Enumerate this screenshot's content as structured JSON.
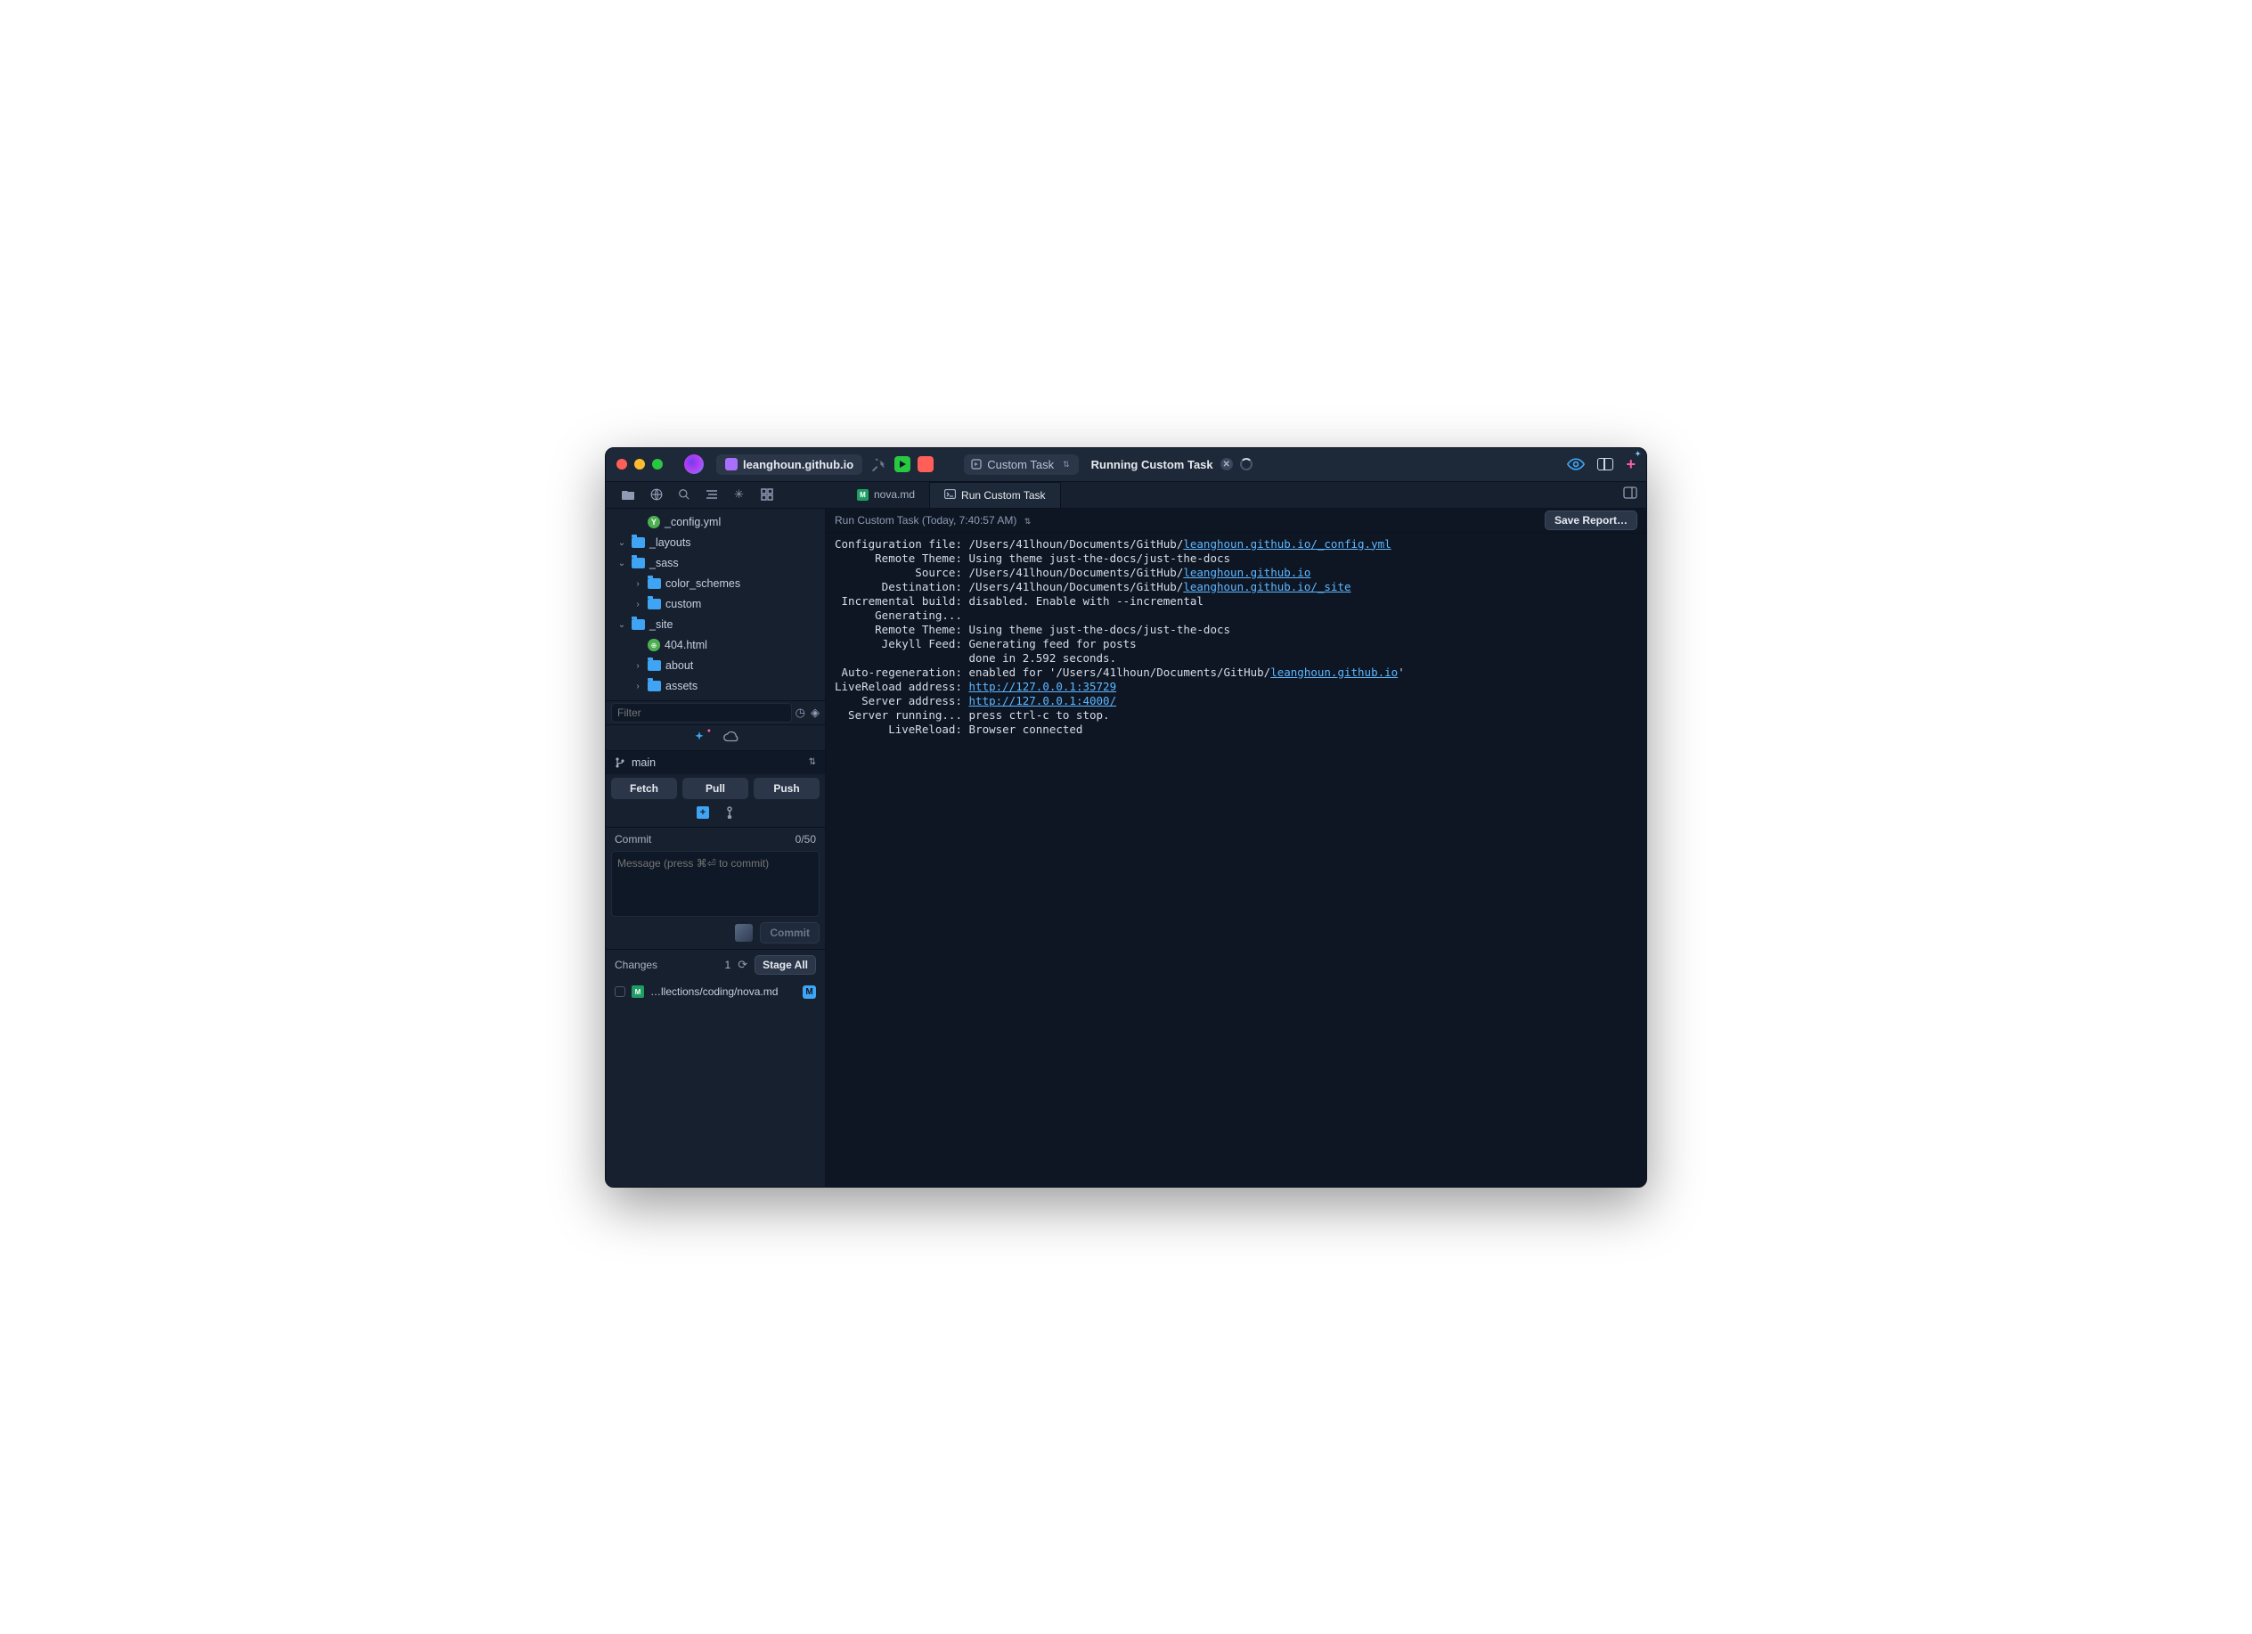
{
  "titlebar": {
    "project_name": "leanghoun.github.io",
    "task_selector_label": "Custom Task",
    "running_label": "Running Custom Task"
  },
  "editor_tabs": [
    {
      "label": "nova.md",
      "active": false
    },
    {
      "label": "Run Custom Task",
      "active": true
    }
  ],
  "file_tree": {
    "items": [
      {
        "depth": 2,
        "type": "file-yml",
        "label": "_config.yml",
        "chevron": ""
      },
      {
        "depth": 1,
        "type": "folder",
        "label": "_layouts",
        "chevron": "v"
      },
      {
        "depth": 1,
        "type": "folder",
        "label": "_sass",
        "chevron": "v"
      },
      {
        "depth": 2,
        "type": "folder",
        "label": "color_schemes",
        "chevron": ">"
      },
      {
        "depth": 2,
        "type": "folder",
        "label": "custom",
        "chevron": ">"
      },
      {
        "depth": 1,
        "type": "folder",
        "label": "_site",
        "chevron": "v"
      },
      {
        "depth": 2,
        "type": "file-html",
        "label": "404.html",
        "chevron": ""
      },
      {
        "depth": 2,
        "type": "folder",
        "label": "about",
        "chevron": ">"
      },
      {
        "depth": 2,
        "type": "folder",
        "label": "assets",
        "chevron": ">"
      }
    ]
  },
  "filter": {
    "placeholder": "Filter"
  },
  "git": {
    "branch": "main",
    "fetch": "Fetch",
    "pull": "Pull",
    "push": "Push",
    "commit_label": "Commit",
    "commit_counter": "0/50",
    "commit_placeholder": "Message (press ⌘⏎ to commit)",
    "commit_button": "Commit",
    "changes_label": "Changes",
    "changes_count": "1",
    "stage_all": "Stage All",
    "changed_file": "…llections/coding/nova.md",
    "changed_badge": "M"
  },
  "breadcrumb": {
    "text": "Run Custom Task (Today, 7:40:57 AM)",
    "save_report": "Save Report…"
  },
  "terminal": {
    "lines": [
      {
        "label": "Configuration file:",
        "pre": " /Users/41lhoun/Documents/GitHub/",
        "link": "leanghoun.github.io/_config.yml",
        "post": ""
      },
      {
        "label": "      Remote Theme:",
        "pre": " Using theme just-the-docs/just-the-docs",
        "link": "",
        "post": ""
      },
      {
        "label": "            Source:",
        "pre": " /Users/41lhoun/Documents/GitHub/",
        "link": "leanghoun.github.io",
        "post": ""
      },
      {
        "label": "       Destination:",
        "pre": " /Users/41lhoun/Documents/GitHub/",
        "link": "leanghoun.github.io/_site",
        "post": ""
      },
      {
        "label": " Incremental build:",
        "pre": " disabled. Enable with --incremental",
        "link": "",
        "post": ""
      },
      {
        "label": "      Generating...",
        "pre": "",
        "link": "",
        "post": ""
      },
      {
        "label": "      Remote Theme:",
        "pre": " Using theme just-the-docs/just-the-docs",
        "link": "",
        "post": ""
      },
      {
        "label": "       Jekyll Feed:",
        "pre": " Generating feed for posts",
        "link": "",
        "post": ""
      },
      {
        "label": "                   ",
        "pre": " done in 2.592 seconds.",
        "link": "",
        "post": ""
      },
      {
        "label": " Auto-regeneration:",
        "pre": " enabled for '/Users/41lhoun/Documents/GitHub/",
        "link": "leanghoun.github.io",
        "post": "'"
      },
      {
        "label": "LiveReload address:",
        "pre": " ",
        "link": "http://127.0.0.1:35729",
        "post": ""
      },
      {
        "label": "    Server address:",
        "pre": " ",
        "link": "http://127.0.0.1:4000/",
        "post": ""
      },
      {
        "label": "  Server running...",
        "pre": " press ctrl-c to stop.",
        "link": "",
        "post": ""
      },
      {
        "label": "        LiveReload:",
        "pre": " Browser connected",
        "link": "",
        "post": ""
      }
    ]
  }
}
